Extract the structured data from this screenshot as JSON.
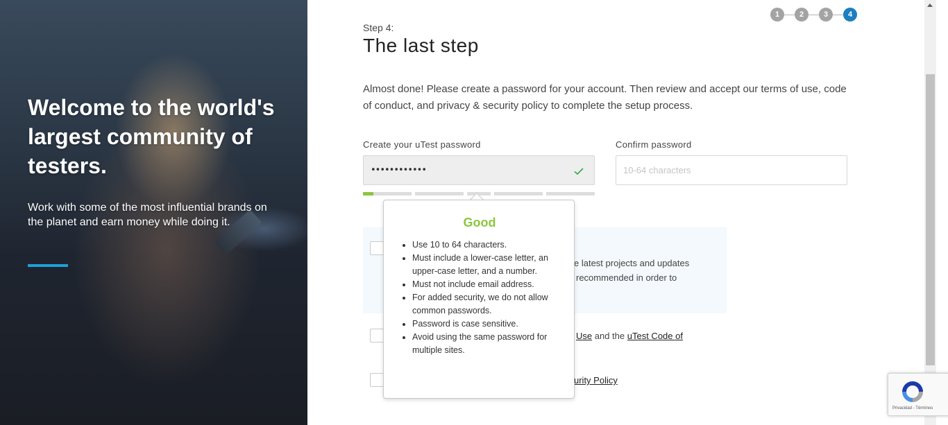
{
  "hero": {
    "title": "Welcome to the world's largest community of testers.",
    "subtitle": "Work with some of the most influential brands on the planet and earn money while doing it.",
    "accent_color": "#1ba3d6"
  },
  "stepper": {
    "steps": [
      "1",
      "2",
      "3",
      "4"
    ],
    "active": "4",
    "active_color": "#1c7fc0",
    "inactive_color": "#a3a3a3"
  },
  "header": {
    "step_label": "Step 4:",
    "title": "The last step"
  },
  "intro": "Almost done! Please create a password for your account. Then review and accept our terms of use, code of conduct, and privacy & security policy to complete the setup process.",
  "password": {
    "label": "Create your uTest password",
    "value": "••••••••••••",
    "valid_icon": "check-icon",
    "strength_segments": 5,
    "strength_fill_fraction_first_segment": 0.2,
    "strength_color": "#8cc63f"
  },
  "confirm": {
    "label": "Confirm password",
    "placeholder": "10-64 characters"
  },
  "tooltip": {
    "title": "Good",
    "title_color": "#8cc63f",
    "rules": [
      "Use 10 to 64 characters.",
      "Must include a lower-case letter, an upper-case letter, and a number.",
      "Must not include email address.",
      "For added security, we do not allow common passwords.",
      "Password is case sensitive.",
      "Avoid using the same password for multiple sites."
    ]
  },
  "agreements": {
    "newsletter_line1": "e latest projects and updates",
    "newsletter_line2": "recommended in order to",
    "terms_link1": "Use",
    "terms_and": "and the",
    "terms_link2": "uTest Code of",
    "privacy_link": "urity Policy"
  },
  "recaptcha": {
    "text": "Privacidad - Términos"
  }
}
